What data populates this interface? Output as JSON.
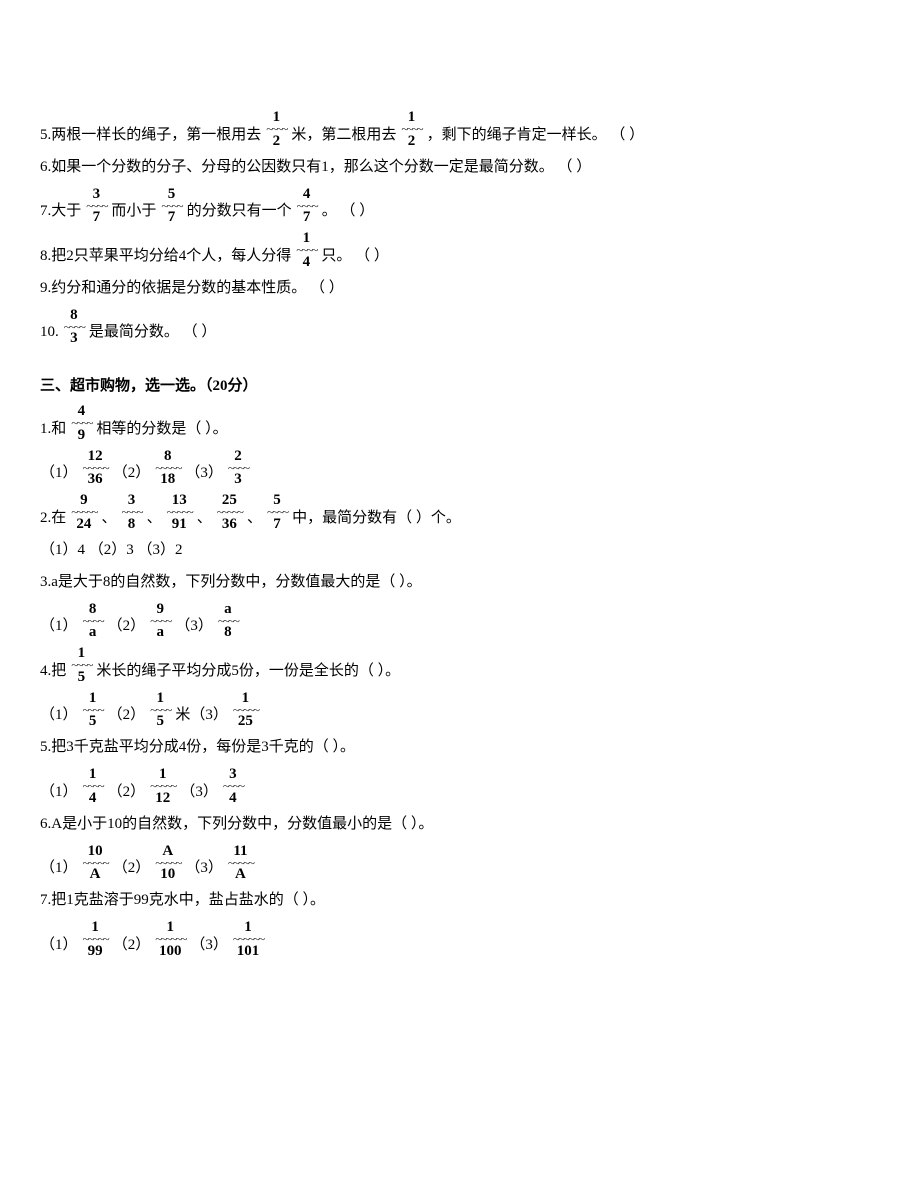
{
  "q5": {
    "p1": "5.两根一样长的绳子，第一根用去",
    "f1": {
      "n": "1",
      "d": "2"
    },
    "p2": "米，第二根用去",
    "f2": {
      "n": "1",
      "d": "2"
    },
    "p3": "，剩下的绳子肯定一样长。  （  ）"
  },
  "q6": "6.如果一个分数的分子、分母的公因数只有1，那么这个分数一定是最简分数。  （  ）",
  "q7": {
    "p1": "7.大于",
    "f1": {
      "n": "3",
      "d": "7"
    },
    "p2": "而小于",
    "f2": {
      "n": "5",
      "d": "7"
    },
    "p3": "的分数只有一个",
    "f3": {
      "n": "4",
      "d": "7"
    },
    "p4": "。  （  ）"
  },
  "q8": {
    "p1": "8.把2只苹果平均分给4个人，每人分得",
    "f1": {
      "n": "1",
      "d": "4"
    },
    "p2": "只。  （  ）"
  },
  "q9": "9.约分和通分的依据是分数的基本性质。  （  ）",
  "q10": {
    "p1": "10.",
    "f1": {
      "n": "8",
      "d": "3"
    },
    "p2": "是最简分数。  （  ）"
  },
  "section3_title": "三、超市购物，选一选。（20分）",
  "s1": {
    "p1": "1.和",
    "f1": {
      "n": "4",
      "d": "9"
    },
    "p2": "相等的分数是（  ）。",
    "opts": {
      "o1": "（1）",
      "f1": {
        "n": "12",
        "d": "36"
      },
      "o2": "（2）",
      "f2": {
        "n": "8",
        "d": "18"
      },
      "o3": "（3）",
      "f3": {
        "n": "2",
        "d": "3"
      }
    }
  },
  "s2": {
    "p1": "2.在",
    "fs": [
      {
        "n": "9",
        "d": "24"
      },
      {
        "n": "3",
        "d": "8"
      },
      {
        "n": "13",
        "d": "91"
      },
      {
        "n": "25",
        "d": "36"
      },
      {
        "n": "5",
        "d": "7"
      }
    ],
    "sep": "、",
    "p2": "中，最简分数有（  ）个。",
    "opts": "（1）4 （2）3 （3）2"
  },
  "s3": {
    "q": "3.a是大于8的自然数，下列分数中，分数值最大的是（  ）。",
    "opts": {
      "o1": "（1）",
      "f1": {
        "n": "8",
        "d": "a"
      },
      "o2": "（2）",
      "f2": {
        "n": "9",
        "d": "a"
      },
      "o3": "（3）",
      "f3": {
        "n": "a",
        "d": "8"
      }
    }
  },
  "s4": {
    "p1": "4.把",
    "f1": {
      "n": "1",
      "d": "5"
    },
    "p2": "米长的绳子平均分成5份，一份是全长的（  ）。",
    "opts": {
      "o1": "（1）",
      "f1": {
        "n": "1",
        "d": "5"
      },
      "o2": "（2）",
      "f2": {
        "n": "1",
        "d": "5"
      },
      "o2t": "米",
      "o3": "（3）",
      "f3": {
        "n": "1",
        "d": "25"
      }
    }
  },
  "s5": {
    "q": "5.把3千克盐平均分成4份，每份是3千克的（  ）。",
    "opts": {
      "o1": "（1）",
      "f1": {
        "n": "1",
        "d": "4"
      },
      "o2": "（2）",
      "f2": {
        "n": "1",
        "d": "12"
      },
      "o3": "（3）",
      "f3": {
        "n": "3",
        "d": "4"
      }
    }
  },
  "s6": {
    "q": "6.A是小于10的自然数，下列分数中，分数值最小的是（  ）。",
    "opts": {
      "o1": "（1）",
      "f1": {
        "n": "10",
        "d": "A"
      },
      "o2": "（2）",
      "f2": {
        "n": "A",
        "d": "10"
      },
      "o3": "（3）",
      "f3": {
        "n": "11",
        "d": "A"
      }
    }
  },
  "s7": {
    "q": "7.把1克盐溶于99克水中，盐占盐水的（  ）。",
    "opts": {
      "o1": "（1）",
      "f1": {
        "n": "1",
        "d": "99"
      },
      "o2": "（2）",
      "f2": {
        "n": "1",
        "d": "100"
      },
      "o3": "（3）",
      "f3": {
        "n": "1",
        "d": "101"
      }
    }
  }
}
